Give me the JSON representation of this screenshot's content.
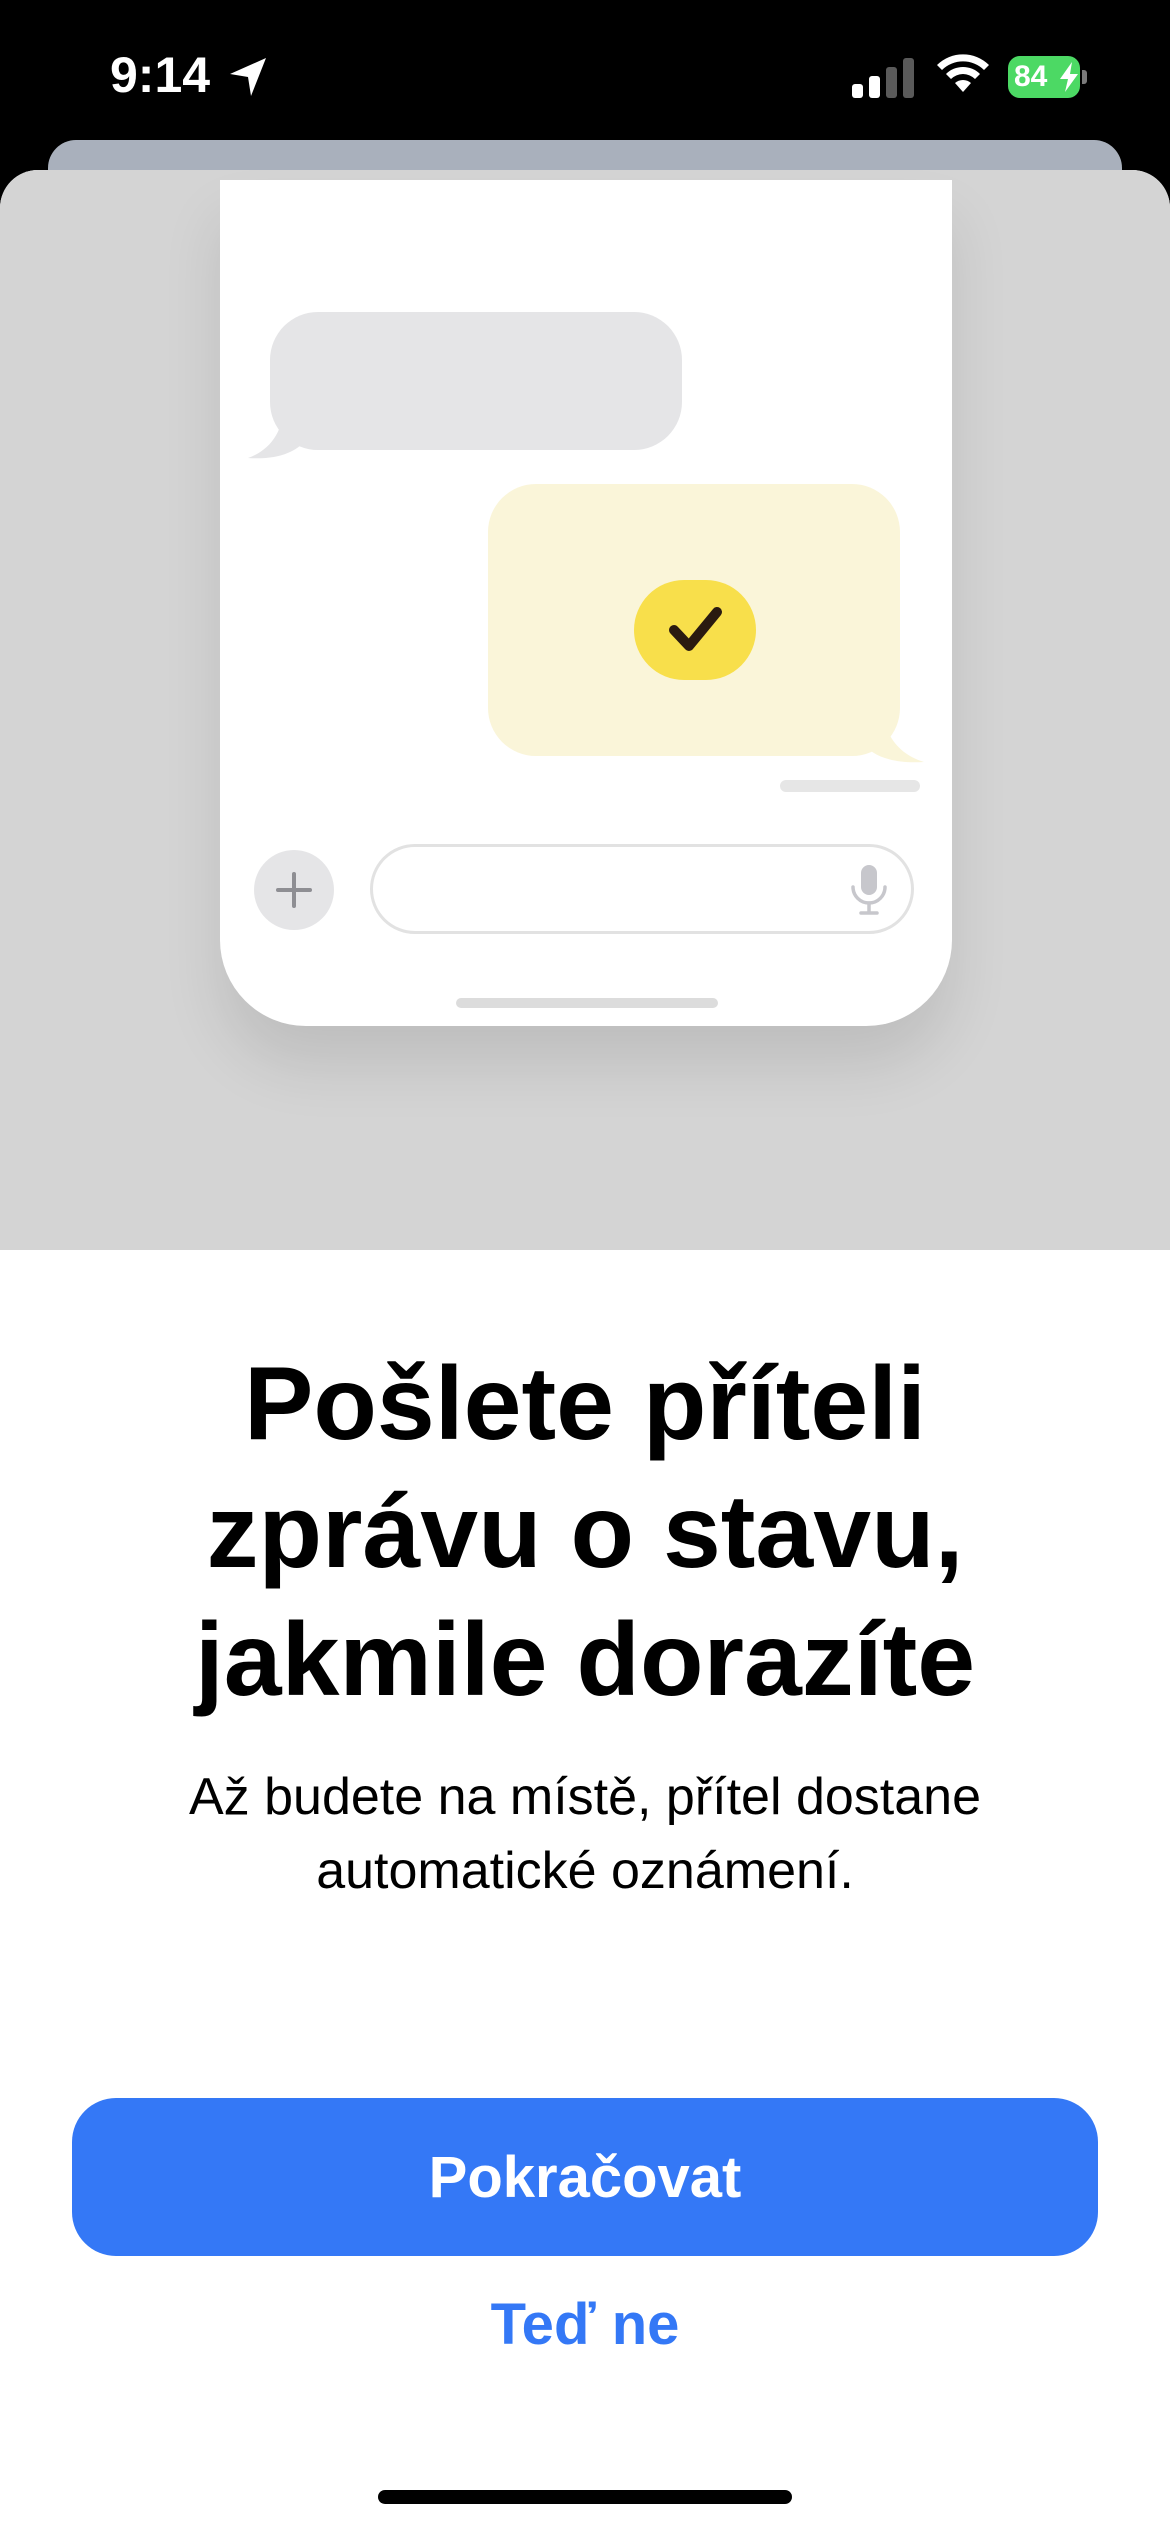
{
  "status_bar": {
    "time": "9:14",
    "battery_percent": "84",
    "icons": [
      "location-arrow-icon",
      "cellular-signal-icon",
      "wifi-icon",
      "battery-charging-icon"
    ]
  },
  "illustration": {
    "icons": [
      "checkmark-icon",
      "plus-icon",
      "microphone-icon"
    ]
  },
  "content": {
    "title": "Pošlete příteli zprávu o stavu, jakmile dorazíte",
    "subtitle": "Až budete na místě, přítel dostane automatické oznámení."
  },
  "actions": {
    "continue_label": "Pokračovat",
    "not_now_label": "Teď ne"
  },
  "colors": {
    "accent": "#3478f6",
    "check_yellow": "#f8df4b",
    "battery_green": "#4cd964"
  }
}
